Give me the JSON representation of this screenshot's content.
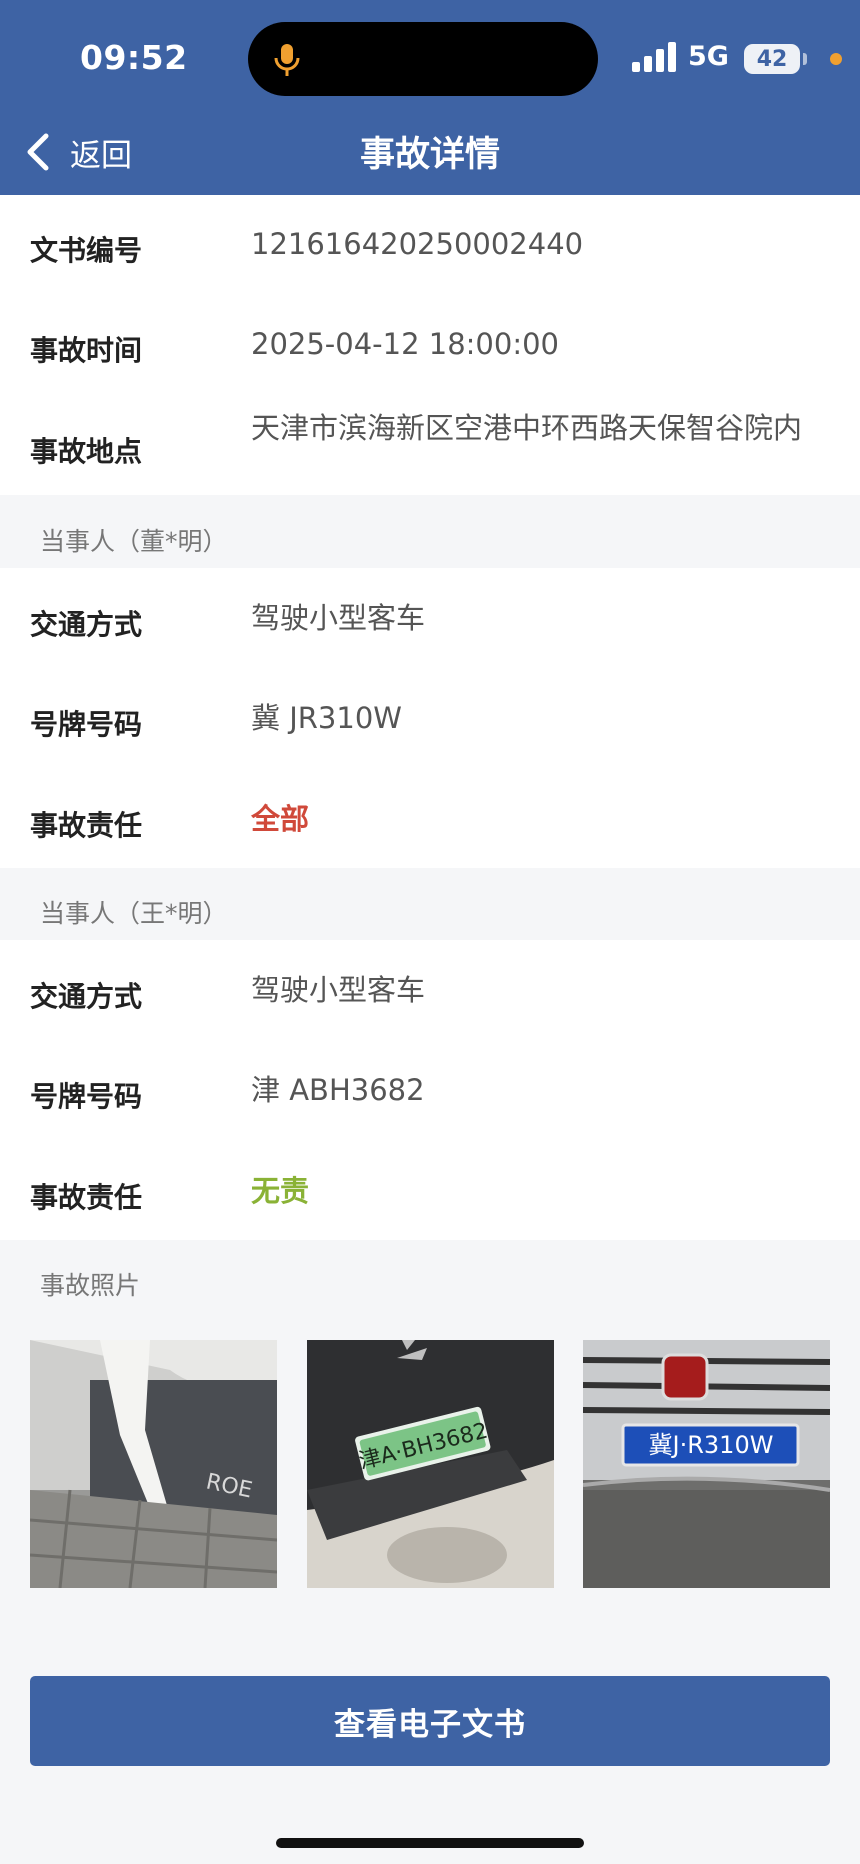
{
  "status_bar": {
    "time": "09:52",
    "network": "5G",
    "battery": "42"
  },
  "nav": {
    "back_label": "返回",
    "title": "事故详情"
  },
  "record": [
    {
      "label": "文书编号",
      "value": "1216164202500024​40"
    },
    {
      "label": "事故时间",
      "value": "2025-04-12 18:00:00"
    },
    {
      "label": "事故地点",
      "value": "天津市滨海新区空港中环西路天保智谷院内"
    }
  ],
  "parties": [
    {
      "heading": "当事人（董*明）",
      "rows": [
        {
          "label": "交通方式",
          "value": "驾驶小型客车"
        },
        {
          "label": "号牌号码",
          "value": "冀 JR310W"
        },
        {
          "label": "事故责任",
          "value": "全部"
        }
      ]
    },
    {
      "heading": "当事人（王*明）",
      "rows": [
        {
          "label": "交通方式",
          "value": "驾驶小型客车"
        },
        {
          "label": "号牌号码",
          "value": "津 ABH3682"
        },
        {
          "label": "事故责任",
          "value": "无责"
        }
      ]
    }
  ],
  "photos": {
    "heading": "事故照片",
    "items": [
      {
        "plate_text": "ROE"
      },
      {
        "plate_text": "津A·BH3682"
      },
      {
        "plate_text": "冀J·R310W"
      }
    ]
  },
  "action": {
    "label": "查看电子文书"
  },
  "colors": {
    "brand": "#3e63a4",
    "liability_full": "#d0493a",
    "liability_none": "#8ab236"
  }
}
